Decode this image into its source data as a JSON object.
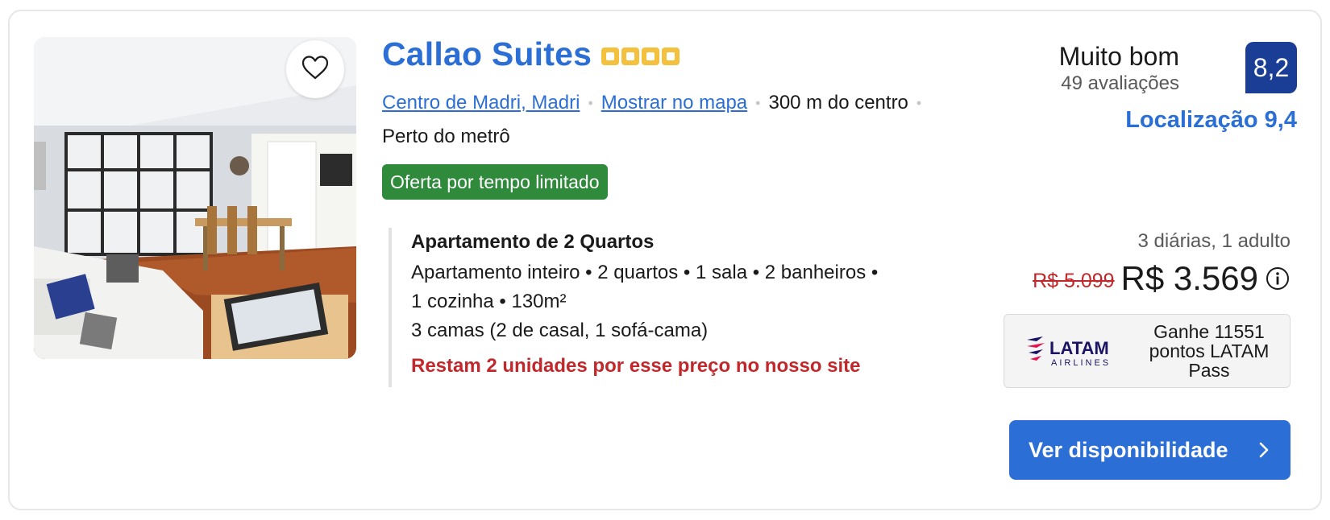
{
  "hotel": {
    "name": "Callao Suites",
    "star_count": 4,
    "location_link": "Centro de Madri, Madri",
    "map_link": "Mostrar no mapa",
    "distance": "300 m do centro",
    "metro": "Perto do metrô",
    "deal_badge": "Oferta por tempo limitado"
  },
  "room": {
    "title": "Apartamento de 2 Quartos",
    "details_line1": "Apartamento inteiro • 2 quartos • 1 sala • 2 banheiros •",
    "details_line2": "1 cozinha • 130m²",
    "beds": "3 camas (2 de casal, 1 sofá-cama)",
    "warning": "Restam 2 unidades por esse preço no nosso site"
  },
  "review": {
    "label": "Muito bom",
    "count": "49 avaliações",
    "score": "8,2",
    "location_score": "Localização 9,4"
  },
  "price": {
    "stay": "3 diárias, 1 adulto",
    "old": "R$ 5.099",
    "new": "R$ 3.569"
  },
  "loyalty": {
    "logo_text": "LATAM",
    "logo_sub": "AIRLINES",
    "text": "Ganhe 11551 pontos LATAM Pass"
  },
  "cta": {
    "label": "Ver disponibilidade"
  },
  "colors": {
    "link": "#2b6fd6",
    "score_bg": "#1a3d96",
    "deal_bg": "#2f8a3c",
    "warning": "#c0282b",
    "star": "#f4c13f"
  },
  "icons": {
    "favorite": "heart-icon",
    "info": "info-icon",
    "cta": "chevron-right-icon"
  }
}
